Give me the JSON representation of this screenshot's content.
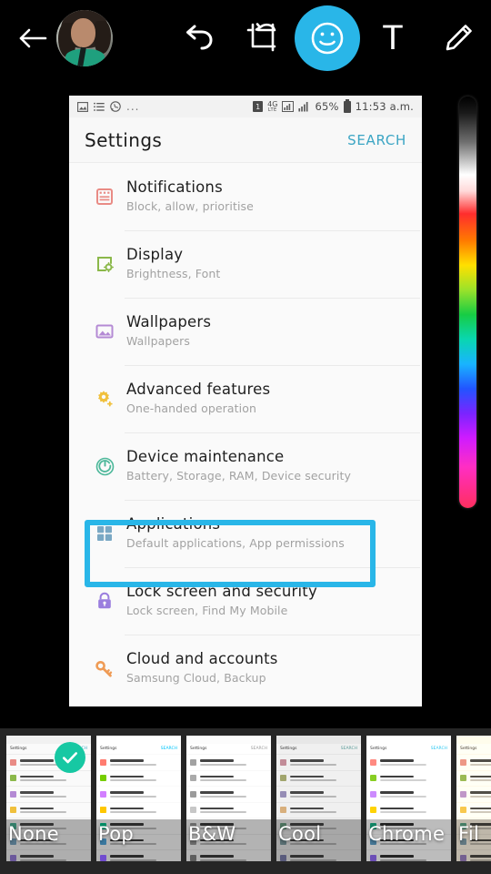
{
  "editor": {
    "back_icon": "back-arrow-icon",
    "avatar_alt": "user-avatar",
    "undo_icon": "undo-icon",
    "crop_icon": "crop-rotate-icon",
    "sticker_icon": "smiley-sticker-icon",
    "text_tool_label": "T",
    "pen_icon": "pencil-icon",
    "accent_color": "#29b6e8",
    "background_color": "#000000"
  },
  "phone": {
    "statusbar": {
      "left_icons": [
        "image-icon",
        "list-icon",
        "whatsapp-icon"
      ],
      "overflow": "...",
      "sim": "1",
      "network": "4G",
      "network_sub": "LTE",
      "battery_percent": "65%",
      "time": "11:53 a.m."
    },
    "header": {
      "title": "Settings",
      "search_label": "SEARCH",
      "search_color": "#3ba5c4"
    },
    "items": [
      {
        "title": "Notifications",
        "subtitle": "Block, allow, prioritise",
        "icon": "notifications-icon",
        "color": "#e98b85"
      },
      {
        "title": "Display",
        "subtitle": "Brightness, Font",
        "icon": "display-icon",
        "color": "#8bb84a"
      },
      {
        "title": "Wallpapers",
        "subtitle": "Wallpapers",
        "icon": "wallpapers-icon",
        "color": "#b48ad4"
      },
      {
        "title": "Advanced features",
        "subtitle": "One-handed operation",
        "icon": "advanced-features-icon",
        "color": "#f0c03c"
      },
      {
        "title": "Device maintenance",
        "subtitle": "Battery, Storage, RAM, Device security",
        "icon": "device-maintenance-icon",
        "color": "#4db89a"
      },
      {
        "title": "Applications",
        "subtitle": "Default applications, App permissions",
        "icon": "applications-icon",
        "color": "#7aa8c4"
      },
      {
        "title": "Lock screen and security",
        "subtitle": "Lock screen, Find My Mobile",
        "icon": "lock-icon",
        "color": "#9a7ede"
      },
      {
        "title": "Cloud and accounts",
        "subtitle": "Samsung Cloud, Backup",
        "icon": "key-icon",
        "color": "#ef9b55"
      }
    ],
    "highlight": {
      "target": "Applications",
      "color": "#29b6e8"
    }
  },
  "color_slider": {
    "name": "color-picker-slider",
    "stops": [
      "#000000",
      "#ffffff",
      "#ff2d2d",
      "#ff7a00",
      "#ffe000",
      "#17cc44",
      "#19b4ff",
      "#2255ff",
      "#cf1bff",
      "#ff2f5f"
    ]
  },
  "filters": {
    "selected": "None",
    "check_color": "#17c8a3",
    "items": [
      {
        "label": "None",
        "style": ""
      },
      {
        "label": "Pop",
        "style": "f-pop"
      },
      {
        "label": "B&W",
        "style": "f-bw"
      },
      {
        "label": "Cool",
        "style": "f-cool"
      },
      {
        "label": "Chrome",
        "style": "f-chrome"
      },
      {
        "label": "Fil",
        "style": "f-fil"
      }
    ]
  }
}
